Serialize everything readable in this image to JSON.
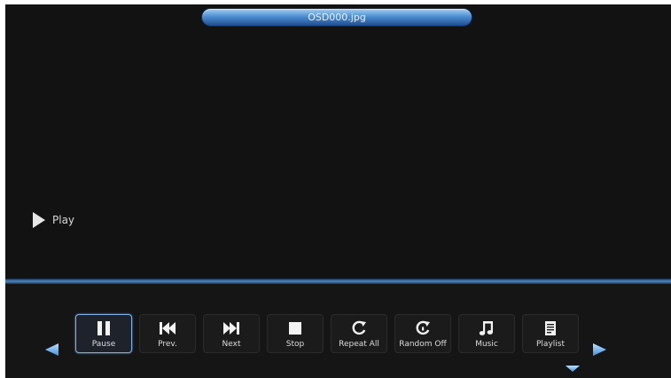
{
  "title": {
    "filename": "OSD000.jpg"
  },
  "status": {
    "icon": "play-icon",
    "label": "Play"
  },
  "controls": {
    "pause": {
      "label": "Pause",
      "icon": "pause-icon",
      "active": true
    },
    "prev": {
      "label": "Prev.",
      "icon": "previous-track-icon"
    },
    "next": {
      "label": "Next",
      "icon": "next-track-icon"
    },
    "stop": {
      "label": "Stop",
      "icon": "stop-icon"
    },
    "repeat": {
      "label": "Repeat All",
      "icon": "repeat-icon"
    },
    "random": {
      "label": "Random Off",
      "icon": "shuffle-icon"
    },
    "music": {
      "label": "Music",
      "icon": "music-note-icon"
    },
    "playlist": {
      "label": "Playlist",
      "icon": "playlist-icon"
    }
  },
  "colors": {
    "accent_blue": "#4d8fd2",
    "background": "#121212",
    "text": "#dcdcdc"
  }
}
